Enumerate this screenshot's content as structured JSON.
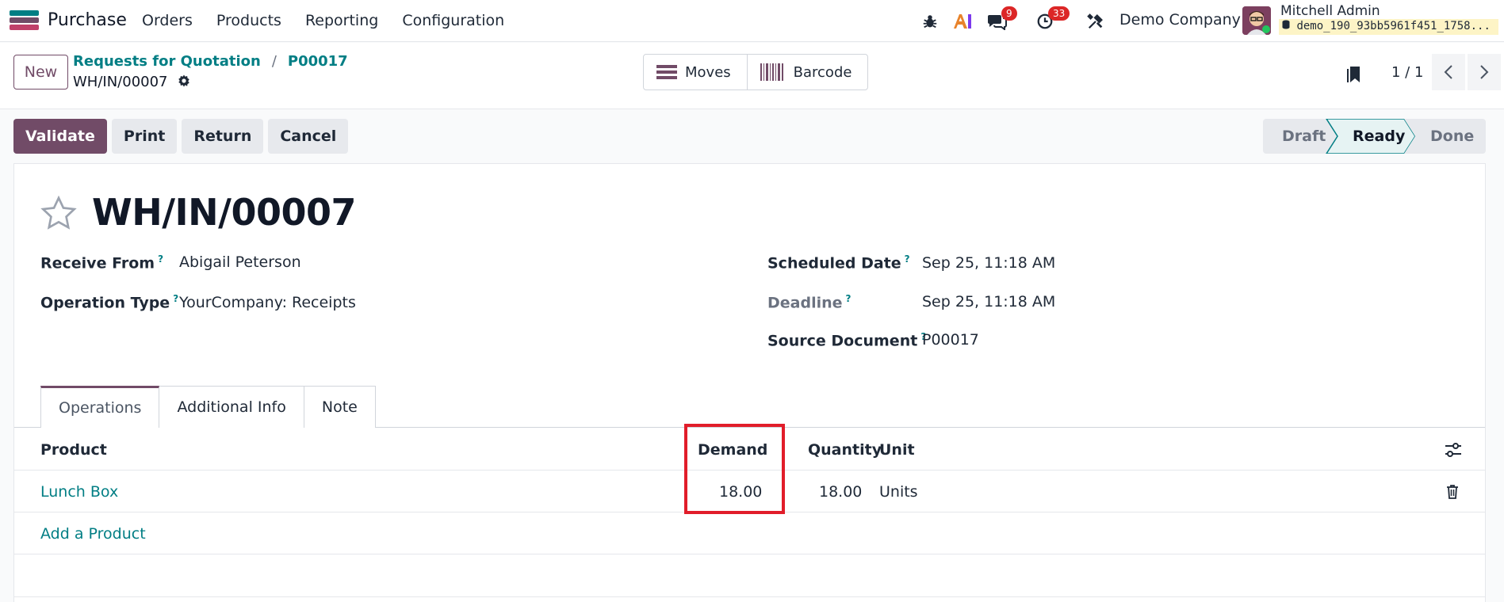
{
  "navbar": {
    "app_name": "Purchase",
    "menu": [
      "Orders",
      "Products",
      "Reporting",
      "Configuration"
    ],
    "messages_badge": "9",
    "activities_badge": "33",
    "company": "Demo Company",
    "user_name": "Mitchell Admin",
    "database": "demo_190_93bb5961f451_1758..."
  },
  "control": {
    "new_label": "New",
    "breadcrumb": [
      "Requests for Quotation",
      "P00017"
    ],
    "record_name": "WH/IN/00007",
    "stat_buttons": [
      "Moves",
      "Barcode"
    ],
    "pager": "1 / 1"
  },
  "actions": {
    "buttons": [
      "Validate",
      "Print",
      "Return",
      "Cancel"
    ],
    "stages": [
      "Draft",
      "Ready",
      "Done"
    ],
    "current_stage": "Ready"
  },
  "form": {
    "title": "WH/IN/00007",
    "fields": {
      "receive_from": {
        "label": "Receive From",
        "value": "Abigail Peterson"
      },
      "operation_type": {
        "label": "Operation Type",
        "value": "YourCompany: Receipts"
      },
      "scheduled_date": {
        "label": "Scheduled Date",
        "value": "Sep 25, 11:18 AM"
      },
      "deadline": {
        "label": "Deadline",
        "value": "Sep 25, 11:18 AM"
      },
      "source_document": {
        "label": "Source Document",
        "value": "P00017"
      }
    },
    "help_mark": "?",
    "tabs": [
      "Operations",
      "Additional Info",
      "Note"
    ],
    "table": {
      "columns": [
        "Product",
        "Demand",
        "Quantity",
        "Unit"
      ],
      "rows": [
        {
          "product": "Lunch Box",
          "demand": "18.00",
          "quantity": "18.00",
          "unit": "Units"
        }
      ],
      "add_label": "Add a Product"
    }
  },
  "colors": {
    "primary": "#714b67",
    "link": "#017e84",
    "highlight": "#e11d2a"
  }
}
